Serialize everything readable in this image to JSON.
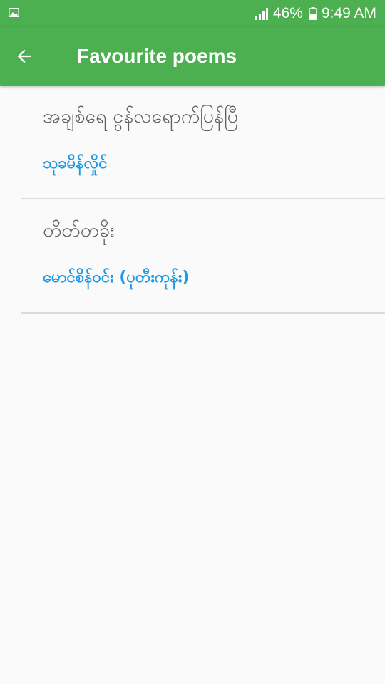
{
  "status_bar": {
    "image_icon": "image-icon",
    "signal_icon": "signal-icon",
    "battery_icon": "battery-icon",
    "battery_percent": "46%",
    "time": "9:49 AM"
  },
  "app_bar": {
    "back_icon": "arrow-back-icon",
    "title": "Favourite poems",
    "color": "#4caf50"
  },
  "poems": [
    {
      "title": "အချစ်ရေ ငွန်လရောက်ပြန်ပြီ",
      "author": "သုခမိန်လှိုင်"
    },
    {
      "title": "တိတ်တခိုး",
      "author": "မောင်စိန်ဝင်း (ပုတီးကုန်း)"
    }
  ],
  "colors": {
    "title_text": "#616161",
    "author_text": "#1e9be6",
    "divider": "#dcdcdc"
  }
}
